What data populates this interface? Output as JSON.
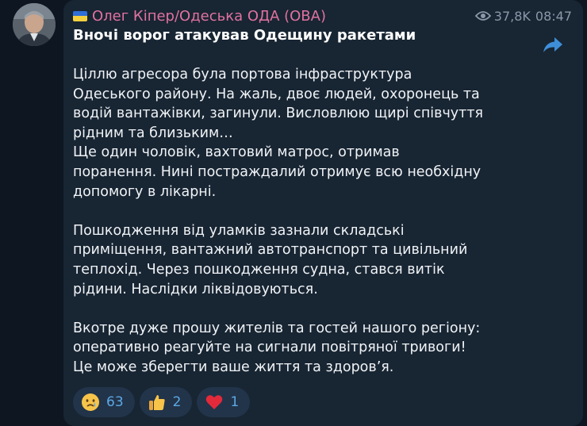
{
  "channel": {
    "sender_name": "Олег Кіпер/Одеська ОДА (ОВА)",
    "flag_icon": "ukraine-flag-icon"
  },
  "message": {
    "views": "37,8K",
    "time": "08:47",
    "title": "Вночі ворог атакував Одещину ракетами",
    "paragraphs": [
      [
        "Ціллю агресора була портова інфраструктура",
        "Одеського району. На жаль, двоє людей, охоронець та",
        "водій вантажівки, загинули. Висловлюю щирі співчуття",
        "рідним та близьким…",
        "Ще один чоловік, вахтовий матрос, отримав",
        "поранення. Нині постраждалий отримує всю необхідну",
        "допомогу в лікарні."
      ],
      [
        "Пошкодження від уламків зазнали складські",
        "приміщення, вантажний автотранспорт та цивільний",
        "теплохід. Через пошкодження судна, стався витік",
        "рідини. Наслідки ліквідовуються."
      ],
      [
        "Вкотре дуже прошу жителів та гостей нашого регіону:",
        "оперативно реагуйте на сигнали повітряної тривоги!",
        "Це може зберегти ваше життя та здоров’я."
      ]
    ]
  },
  "reactions": [
    {
      "icon": "crying-face-icon",
      "count": "63"
    },
    {
      "icon": "thumbs-up-icon",
      "count": "2"
    },
    {
      "icon": "red-heart-icon",
      "count": "1"
    }
  ],
  "colors": {
    "background": "#0e1621",
    "bubble": "#182533",
    "sender": "#e072a0",
    "reaction_count": "#5ca8e4"
  }
}
